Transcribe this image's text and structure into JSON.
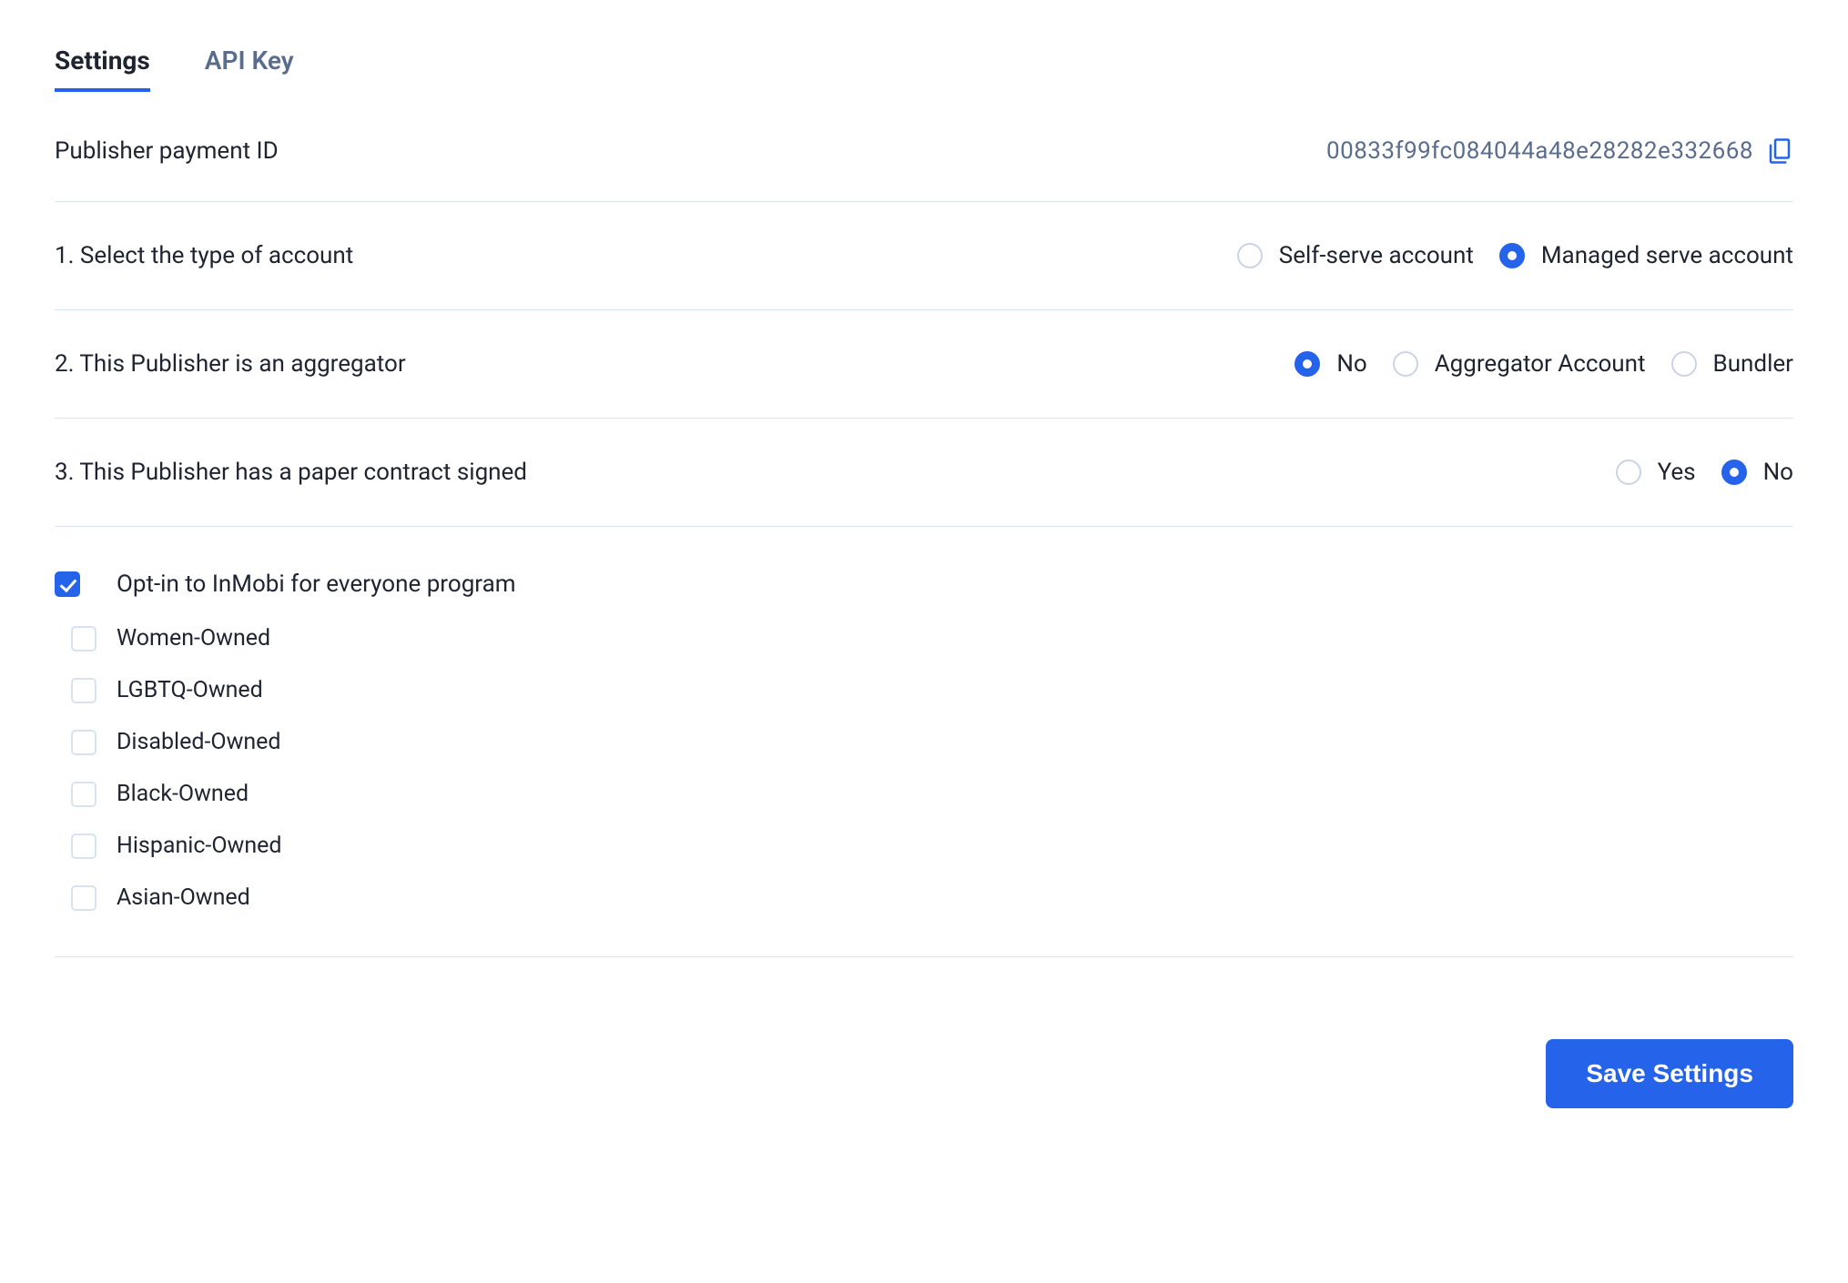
{
  "colors": {
    "accent": "#2563eb",
    "text_dark": "#1e2430",
    "text_muted": "#5a6d8c"
  },
  "tabs": {
    "settings": "Settings",
    "api_key": "API Key",
    "active": "settings"
  },
  "payment_id": {
    "label": "Publisher payment ID",
    "value": "00833f99fc084044a48e28282e332668"
  },
  "questions": {
    "account_type": {
      "label": "1. Select the type of account",
      "options": {
        "self_serve": "Self-serve account",
        "managed_serve": "Managed serve account"
      },
      "selected": "managed_serve"
    },
    "aggregator": {
      "label": "2. This Publisher is an aggregator",
      "options": {
        "no": "No",
        "aggregator_account": "Aggregator Account",
        "bundler": "Bundler"
      },
      "selected": "no"
    },
    "paper_contract": {
      "label": "3. This Publisher has a paper contract signed",
      "options": {
        "yes": "Yes",
        "no": "No"
      },
      "selected": "no"
    }
  },
  "opt_in": {
    "label": "Opt-in to InMobi for everyone program",
    "checked": true,
    "categories": {
      "women_owned": {
        "label": "Women-Owned",
        "checked": false
      },
      "lgbtq_owned": {
        "label": "LGBTQ-Owned",
        "checked": false
      },
      "disabled_owned": {
        "label": "Disabled-Owned",
        "checked": false
      },
      "black_owned": {
        "label": "Black-Owned",
        "checked": false
      },
      "hispanic_owned": {
        "label": "Hispanic-Owned",
        "checked": false
      },
      "asian_owned": {
        "label": "Asian-Owned",
        "checked": false
      }
    }
  },
  "actions": {
    "save": "Save Settings"
  }
}
